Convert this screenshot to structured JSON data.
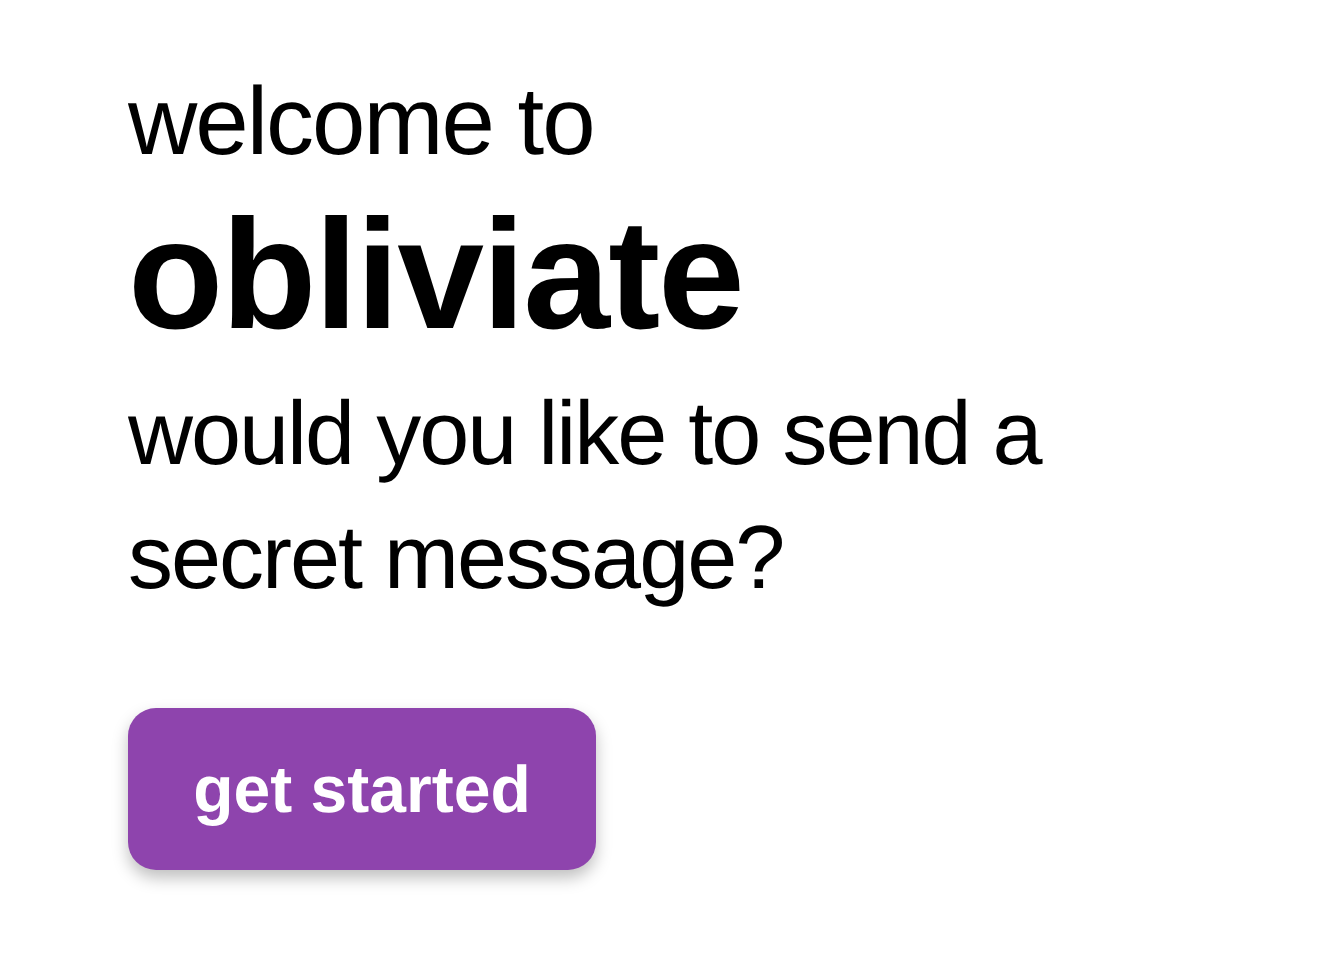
{
  "greeting": "welcome to",
  "app_name": "obliviate",
  "prompt": "would you like to send a secret message?",
  "button": {
    "label": "get started"
  }
}
